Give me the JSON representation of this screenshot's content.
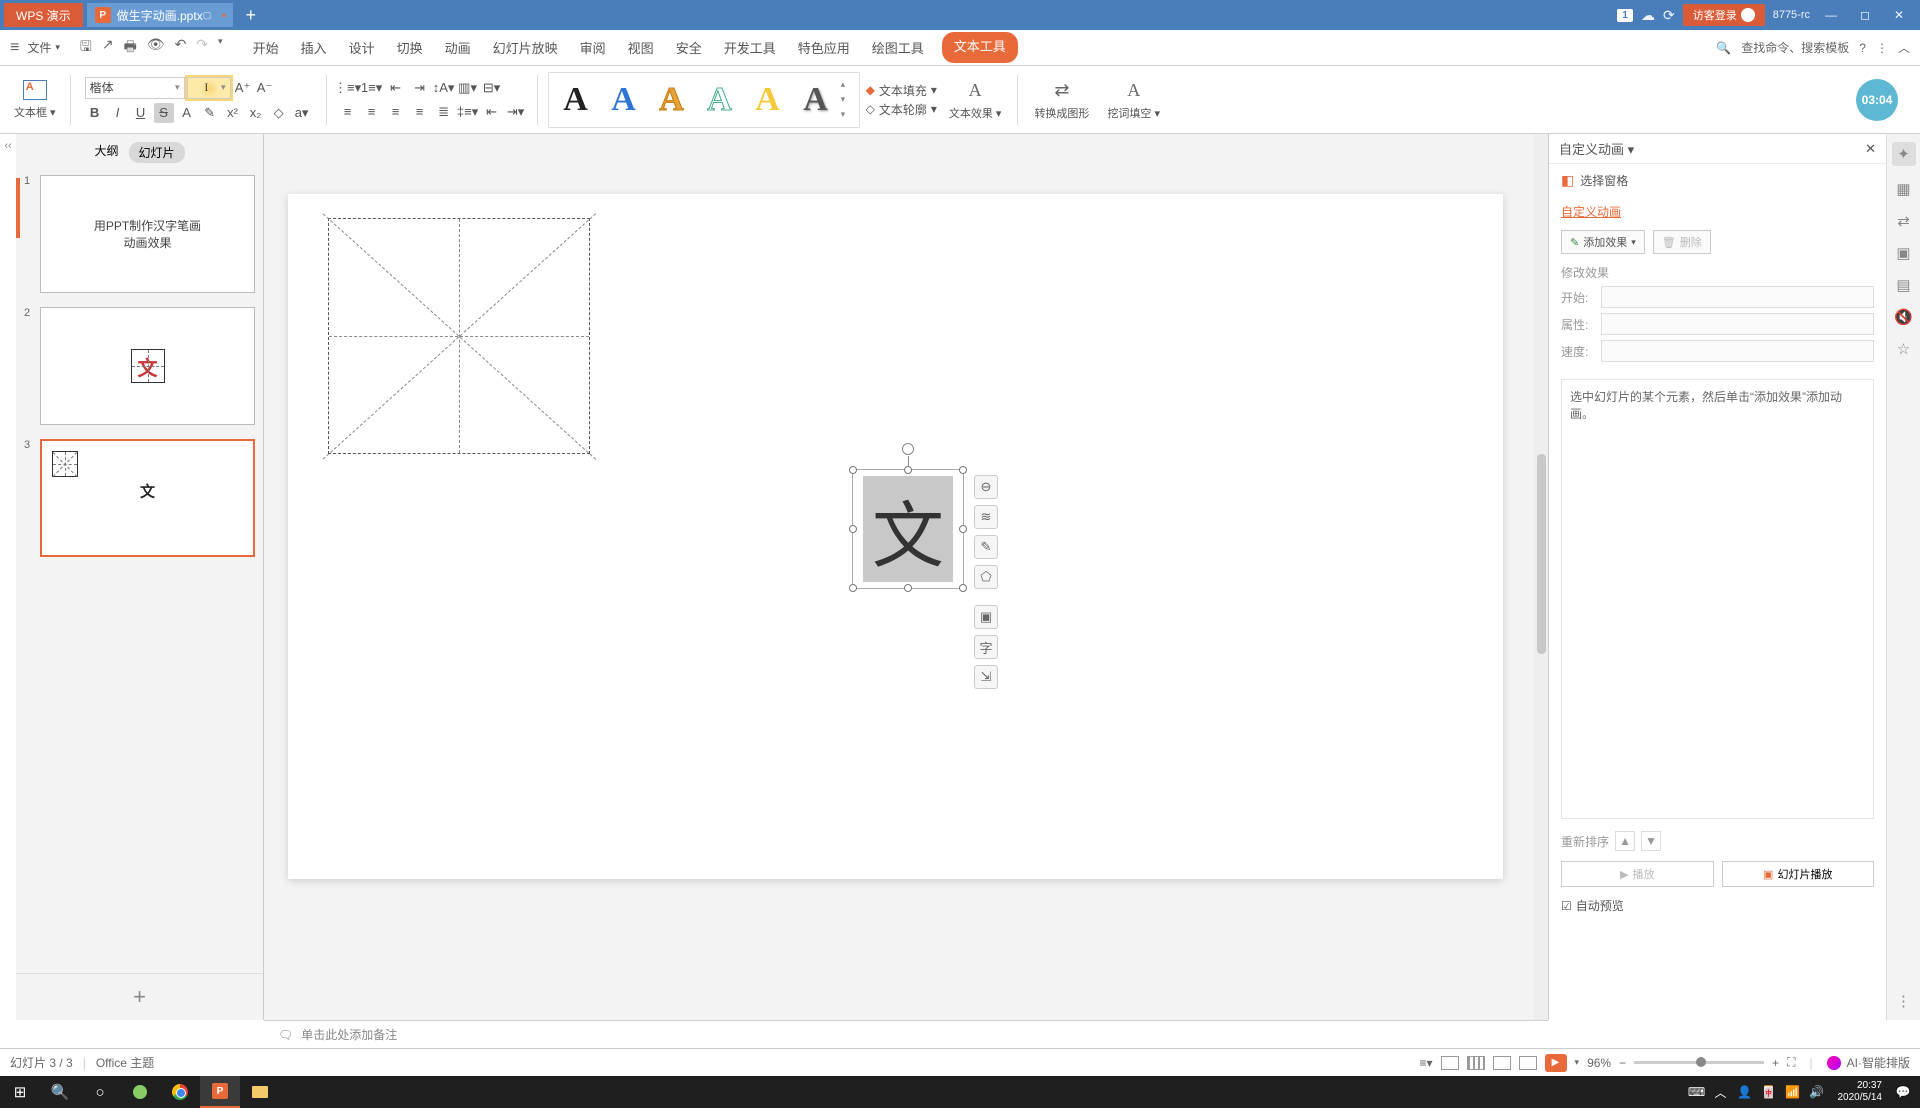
{
  "titlebar": {
    "app": "WPS 演示",
    "doc_name": "做生字动画.pptx",
    "login": "访客登录",
    "build": "8775-rc",
    "badge": "1"
  },
  "menubar": {
    "file": "文件",
    "tabs": [
      "开始",
      "插入",
      "设计",
      "切换",
      "动画",
      "幻灯片放映",
      "审阅",
      "视图",
      "安全",
      "开发工具",
      "特色应用",
      "绘图工具",
      "文本工具"
    ],
    "search_hint": "查找命令、搜索模板"
  },
  "ribbon": {
    "textbox_label": "文本框",
    "font_name": "楷体",
    "font_size": "",
    "text_fill": "文本填充",
    "text_outline": "文本轮廓",
    "text_effect": "文本效果",
    "to_shape": "转换成图形",
    "cloze": "挖词填空",
    "time": "03:04"
  },
  "thumbs": {
    "outline": "大纲",
    "slides": "幻灯片",
    "items": [
      {
        "n": "1",
        "title": "用PPT制作汉字笔画\n动画效果"
      },
      {
        "n": "2",
        "char": "文"
      },
      {
        "n": "3",
        "char": "文"
      }
    ]
  },
  "canvas": {
    "char": "文"
  },
  "sidepanel": {
    "title": "自定义动画",
    "select_pane": "选择窗格",
    "section": "自定义动画",
    "add_effect": "添加效果",
    "delete": "删除",
    "modify": "修改效果",
    "start": "开始:",
    "property": "属性:",
    "speed": "速度:",
    "hint": "选中幻灯片的某个元素，然后单击“添加效果”添加动画。",
    "reorder": "重新排序",
    "play": "播放",
    "slideshow": "幻灯片播放",
    "autopreview": "自动预览"
  },
  "notes": {
    "placeholder": "单击此处添加备注"
  },
  "status": {
    "slide_info": "幻灯片 3 / 3",
    "theme": "Office 主题",
    "zoom": "96%",
    "ai": "AI·智能排版"
  },
  "taskbar": {
    "time": "20:37",
    "date": "2020/5/14"
  }
}
